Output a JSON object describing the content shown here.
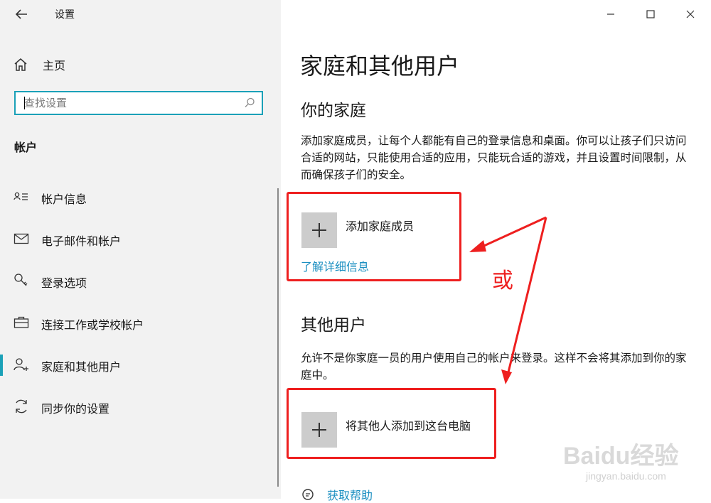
{
  "app": {
    "title": "设置"
  },
  "sidebar": {
    "home_label": "主页",
    "search_placeholder": "查找设置",
    "section_heading": "帐户",
    "items": [
      {
        "label": "帐户信息",
        "icon": "account-info-icon"
      },
      {
        "label": "电子邮件和帐户",
        "icon": "mail-icon"
      },
      {
        "label": "登录选项",
        "icon": "key-icon"
      },
      {
        "label": "连接工作或学校帐户",
        "icon": "briefcase-icon"
      },
      {
        "label": "家庭和其他用户",
        "icon": "add-person-icon",
        "active": true
      },
      {
        "label": "同步你的设置",
        "icon": "sync-icon"
      }
    ]
  },
  "main": {
    "title": "家庭和其他用户",
    "family": {
      "heading": "你的家庭",
      "description": "添加家庭成员，让每个人都能有自己的登录信息和桌面。你可以让孩子们只访问合适的网站，只能使用合适的应用，只能玩合适的游戏，并且设置时间限制，从而确保孩子们的安全。",
      "add_label": "添加家庭成员",
      "learn_more": "了解详细信息"
    },
    "others": {
      "heading": "其他用户",
      "description": "允许不是你家庭一员的用户使用自己的帐户来登录。这样不会将其添加到你的家庭中。",
      "add_label": "将其他人添加到这台电脑"
    },
    "help": {
      "label": "获取帮助"
    }
  },
  "annotation": {
    "text": "或",
    "color": "#ee1f1f"
  },
  "watermark": {
    "brand": "Baidu经验",
    "url": "jingyan.baidu.com"
  },
  "colors": {
    "accent": "#1ba1b8",
    "link": "#1b8fc1",
    "sidebar_bg": "#f2f2f2"
  }
}
